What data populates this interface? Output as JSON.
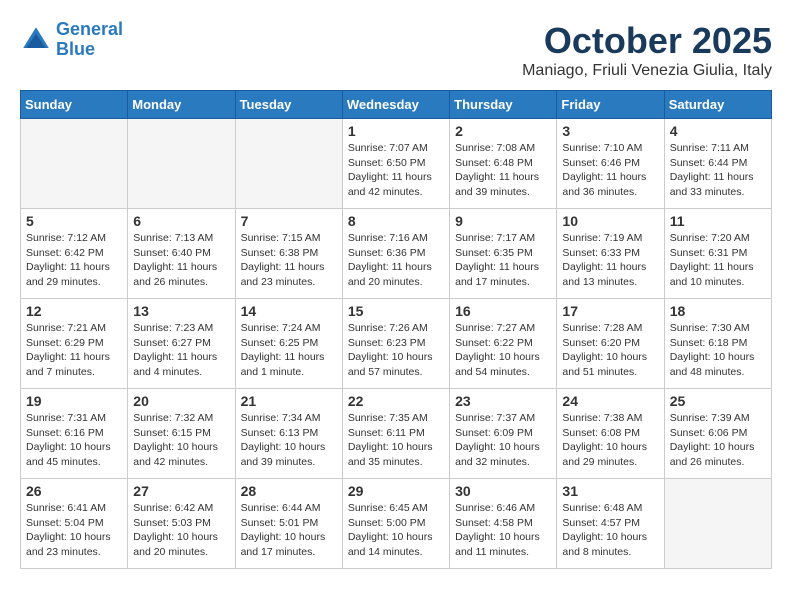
{
  "header": {
    "logo_line1": "General",
    "logo_line2": "Blue",
    "title": "October 2025",
    "subtitle": "Maniago, Friuli Venezia Giulia, Italy"
  },
  "weekdays": [
    "Sunday",
    "Monday",
    "Tuesday",
    "Wednesday",
    "Thursday",
    "Friday",
    "Saturday"
  ],
  "weeks": [
    [
      {
        "day": "",
        "empty": true
      },
      {
        "day": "",
        "empty": true
      },
      {
        "day": "",
        "empty": true
      },
      {
        "day": "1",
        "sunrise": "7:07 AM",
        "sunset": "6:50 PM",
        "daylight": "11 hours and 42 minutes."
      },
      {
        "day": "2",
        "sunrise": "7:08 AM",
        "sunset": "6:48 PM",
        "daylight": "11 hours and 39 minutes."
      },
      {
        "day": "3",
        "sunrise": "7:10 AM",
        "sunset": "6:46 PM",
        "daylight": "11 hours and 36 minutes."
      },
      {
        "day": "4",
        "sunrise": "7:11 AM",
        "sunset": "6:44 PM",
        "daylight": "11 hours and 33 minutes."
      }
    ],
    [
      {
        "day": "5",
        "sunrise": "7:12 AM",
        "sunset": "6:42 PM",
        "daylight": "11 hours and 29 minutes."
      },
      {
        "day": "6",
        "sunrise": "7:13 AM",
        "sunset": "6:40 PM",
        "daylight": "11 hours and 26 minutes."
      },
      {
        "day": "7",
        "sunrise": "7:15 AM",
        "sunset": "6:38 PM",
        "daylight": "11 hours and 23 minutes."
      },
      {
        "day": "8",
        "sunrise": "7:16 AM",
        "sunset": "6:36 PM",
        "daylight": "11 hours and 20 minutes."
      },
      {
        "day": "9",
        "sunrise": "7:17 AM",
        "sunset": "6:35 PM",
        "daylight": "11 hours and 17 minutes."
      },
      {
        "day": "10",
        "sunrise": "7:19 AM",
        "sunset": "6:33 PM",
        "daylight": "11 hours and 13 minutes."
      },
      {
        "day": "11",
        "sunrise": "7:20 AM",
        "sunset": "6:31 PM",
        "daylight": "11 hours and 10 minutes."
      }
    ],
    [
      {
        "day": "12",
        "sunrise": "7:21 AM",
        "sunset": "6:29 PM",
        "daylight": "11 hours and 7 minutes."
      },
      {
        "day": "13",
        "sunrise": "7:23 AM",
        "sunset": "6:27 PM",
        "daylight": "11 hours and 4 minutes."
      },
      {
        "day": "14",
        "sunrise": "7:24 AM",
        "sunset": "6:25 PM",
        "daylight": "11 hours and 1 minute."
      },
      {
        "day": "15",
        "sunrise": "7:26 AM",
        "sunset": "6:23 PM",
        "daylight": "10 hours and 57 minutes."
      },
      {
        "day": "16",
        "sunrise": "7:27 AM",
        "sunset": "6:22 PM",
        "daylight": "10 hours and 54 minutes."
      },
      {
        "day": "17",
        "sunrise": "7:28 AM",
        "sunset": "6:20 PM",
        "daylight": "10 hours and 51 minutes."
      },
      {
        "day": "18",
        "sunrise": "7:30 AM",
        "sunset": "6:18 PM",
        "daylight": "10 hours and 48 minutes."
      }
    ],
    [
      {
        "day": "19",
        "sunrise": "7:31 AM",
        "sunset": "6:16 PM",
        "daylight": "10 hours and 45 minutes."
      },
      {
        "day": "20",
        "sunrise": "7:32 AM",
        "sunset": "6:15 PM",
        "daylight": "10 hours and 42 minutes."
      },
      {
        "day": "21",
        "sunrise": "7:34 AM",
        "sunset": "6:13 PM",
        "daylight": "10 hours and 39 minutes."
      },
      {
        "day": "22",
        "sunrise": "7:35 AM",
        "sunset": "6:11 PM",
        "daylight": "10 hours and 35 minutes."
      },
      {
        "day": "23",
        "sunrise": "7:37 AM",
        "sunset": "6:09 PM",
        "daylight": "10 hours and 32 minutes."
      },
      {
        "day": "24",
        "sunrise": "7:38 AM",
        "sunset": "6:08 PM",
        "daylight": "10 hours and 29 minutes."
      },
      {
        "day": "25",
        "sunrise": "7:39 AM",
        "sunset": "6:06 PM",
        "daylight": "10 hours and 26 minutes."
      }
    ],
    [
      {
        "day": "26",
        "sunrise": "6:41 AM",
        "sunset": "5:04 PM",
        "daylight": "10 hours and 23 minutes."
      },
      {
        "day": "27",
        "sunrise": "6:42 AM",
        "sunset": "5:03 PM",
        "daylight": "10 hours and 20 minutes."
      },
      {
        "day": "28",
        "sunrise": "6:44 AM",
        "sunset": "5:01 PM",
        "daylight": "10 hours and 17 minutes."
      },
      {
        "day": "29",
        "sunrise": "6:45 AM",
        "sunset": "5:00 PM",
        "daylight": "10 hours and 14 minutes."
      },
      {
        "day": "30",
        "sunrise": "6:46 AM",
        "sunset": "4:58 PM",
        "daylight": "10 hours and 11 minutes."
      },
      {
        "day": "31",
        "sunrise": "6:48 AM",
        "sunset": "4:57 PM",
        "daylight": "10 hours and 8 minutes."
      },
      {
        "day": "",
        "empty": true
      }
    ]
  ]
}
